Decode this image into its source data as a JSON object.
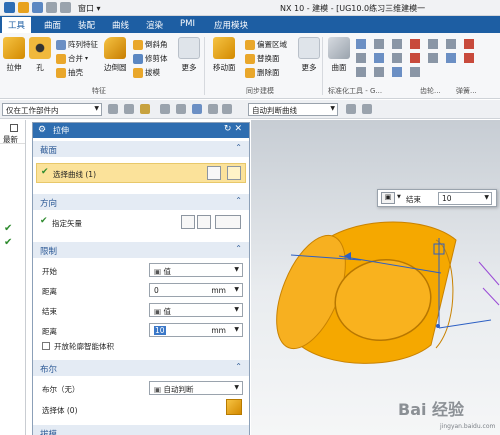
{
  "titlebar": {
    "window_menu": "窗口",
    "title": "NX 10 - 建模 - [UG10.0练习三维建模一"
  },
  "menubar": {
    "tabs": [
      "工具",
      "曲面",
      "装配",
      "曲线",
      "渲染",
      "PMI",
      "应用模块"
    ],
    "active_tab": "工具"
  },
  "ribbon": {
    "big": [
      "拉伸",
      "孔",
      "边倒圆",
      "更多",
      "移动面",
      "更多",
      "曲面"
    ],
    "small": [
      "阵列特征",
      "合并",
      "抽壳",
      "倒斜角",
      "修剪体",
      "拔模",
      "偏置区域",
      "替换面",
      "删除面"
    ],
    "groups": [
      "特征",
      "同步建模",
      "标准化工具 - G...",
      "齿轮...",
      "弹簧..."
    ]
  },
  "selbar": {
    "filter": "仅在工作部件内",
    "curve_rule": "自动判断曲线"
  },
  "leftstrip": {
    "header": "最新"
  },
  "dialog": {
    "title": "拉伸",
    "section": {
      "header": "截面",
      "select_curve": "选择曲线 (1)"
    },
    "direction": {
      "header": "方向",
      "vector_label": "指定矢量"
    },
    "limits": {
      "header": "限制",
      "start_label": "开始",
      "start_value": "值",
      "dist1_label": "距离",
      "dist1_value": "0",
      "dist1_unit": "mm",
      "end_label": "结束",
      "end_value": "值",
      "dist2_label": "距离",
      "dist2_value": "10",
      "dist2_unit": "mm",
      "open_profile": "开放轮廓智能体积"
    },
    "boolean": {
      "header": "布尔",
      "label": "布尔（无）",
      "value": "自动判断",
      "select_body": "选择体 (0)"
    },
    "draft": {
      "header": "拔模"
    }
  },
  "viewport": {
    "float_label": "结束",
    "float_value": "10"
  },
  "colors": {
    "accent": "#1d5ea3",
    "solid": "#f5a800",
    "highlight": "#fbe29a"
  },
  "watermark": {
    "text": "Bai 经验",
    "url": "jingyan.baidu.com"
  }
}
